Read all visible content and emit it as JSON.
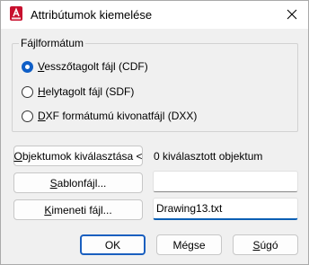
{
  "window": {
    "title": "Attribútumok kiemelése",
    "app_icon_letter": "A",
    "app_icon_color": "#c8102e"
  },
  "format_group": {
    "label": "Fájlformátum",
    "options": [
      {
        "pre": "",
        "key": "V",
        "post": "esszőtagolt fájl (CDF)",
        "selected": true
      },
      {
        "pre": "",
        "key": "H",
        "post": "elytagolt fájl (SDF)",
        "selected": false
      },
      {
        "pre": "",
        "key": "D",
        "post": "XF formátumú kivonatfájl (DXX)",
        "selected": false
      }
    ]
  },
  "select_objects": {
    "pre": "",
    "key": "O",
    "post": "bjektumok kiválasztása <",
    "status": "0 kiválasztott objektum"
  },
  "template": {
    "pre": "",
    "key": "S",
    "post": "ablonfájl...",
    "value": ""
  },
  "output": {
    "pre": "",
    "key": "K",
    "post": "imeneti fájl...",
    "value": "Drawing13.txt"
  },
  "footer": {
    "ok": "OK",
    "cancel": "Mégse",
    "help_pre": "",
    "help_key": "S",
    "help_post": "úgó"
  },
  "colors": {
    "accent": "#1a5fbf",
    "radio_selected": "#0f5fc7"
  }
}
